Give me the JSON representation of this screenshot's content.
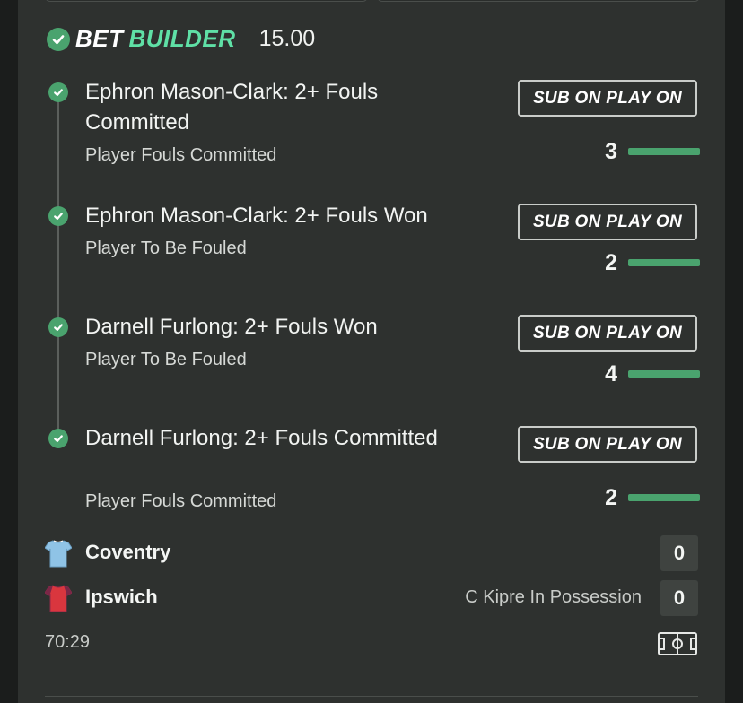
{
  "header": {
    "bet_word": "BET",
    "builder_word": "BUILDER",
    "odds": "15.00"
  },
  "legs": [
    {
      "title": "Ephron Mason-Clark: 2+ Fouls Committed",
      "market": "Player Fouls Committed",
      "button_label": "SUB ON PLAY ON",
      "count": "3",
      "status": "won"
    },
    {
      "title": "Ephron Mason-Clark: 2+ Fouls Won",
      "market": "Player To Be Fouled",
      "button_label": "SUB ON PLAY ON",
      "count": "2",
      "status": "won"
    },
    {
      "title": "Darnell Furlong: 2+ Fouls Won",
      "market": "Player To Be Fouled",
      "button_label": "SUB ON PLAY ON",
      "count": "4",
      "status": "won"
    },
    {
      "title": "Darnell Furlong: 2+ Fouls Committed",
      "market": "Player Fouls Committed",
      "button_label": "SUB ON PLAY ON",
      "count": "2",
      "status": "won"
    }
  ],
  "match": {
    "home": {
      "name": "Coventry",
      "score": "0",
      "shirt_icon": "sky-blue-shirt-icon"
    },
    "away": {
      "name": "Ipswich",
      "score": "0",
      "shirt_icon": "claret-shirt-icon"
    },
    "status_text": "C Kipre In Possession",
    "clock": "70:29"
  },
  "colors": {
    "accent_green": "#4aa36e",
    "builder_green": "#5fe0a6",
    "card_bg": "#2e312f"
  }
}
